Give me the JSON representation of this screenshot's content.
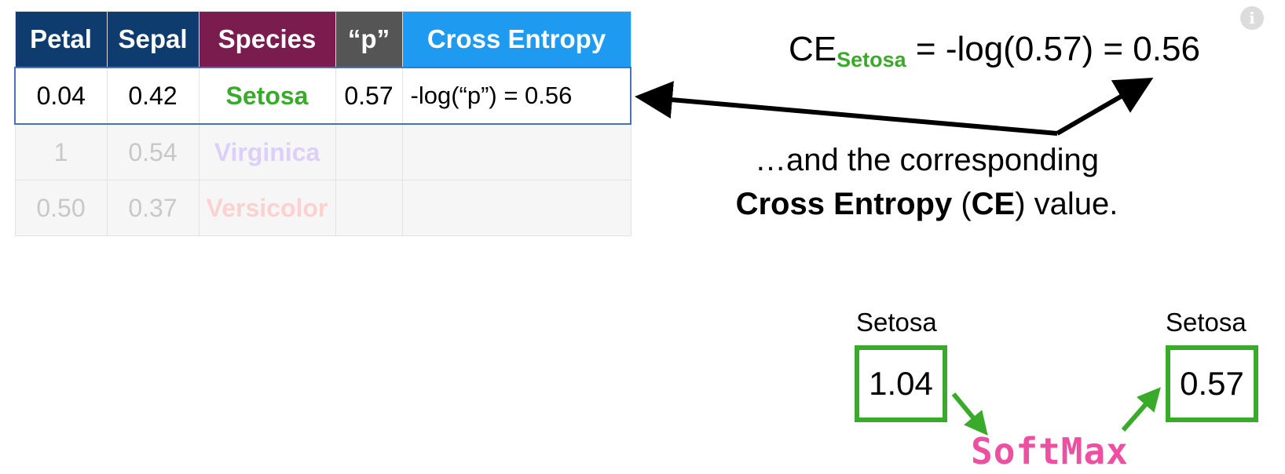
{
  "colors": {
    "petal": "#0e3c6e",
    "sepal": "#0e3c6e",
    "species": "#7b1c4e",
    "p": "#555555",
    "ce": "#1e9bf0",
    "setosa": "#3aaa2a",
    "virginica": "#ddd0f8",
    "versicolor": "#fbd2cf",
    "softmax": "#ee4fa0"
  },
  "table": {
    "headers": [
      "Petal",
      "Sepal",
      "Species",
      "“p”",
      "Cross Entropy"
    ],
    "rows": [
      {
        "petal": "0.04",
        "sepal": "0.42",
        "species": "Setosa",
        "p": "0.57",
        "ce": "-log(“p”) = 0.56"
      },
      {
        "petal": "1",
        "sepal": "0.54",
        "species": "Virginica",
        "p": "",
        "ce": ""
      },
      {
        "petal": "0.50",
        "sepal": "0.37",
        "species": "Versicolor",
        "p": "",
        "ce": ""
      }
    ]
  },
  "equation": {
    "prefix": "CE",
    "subscript": "Setosa",
    "rest": " = -log(0.57) = 0.56"
  },
  "caption": {
    "line1": "…and the corresponding",
    "bold1": "Cross Entropy",
    "mid": " (",
    "bold2": "CE",
    "end": ") value."
  },
  "softmax_diagram": {
    "input_label": "Setosa",
    "input_value": "1.04",
    "output_label": "Setosa",
    "output_value": "0.57",
    "function_label": "SoftMax"
  },
  "icons": {
    "info": "info-icon"
  },
  "info_glyph": "i"
}
